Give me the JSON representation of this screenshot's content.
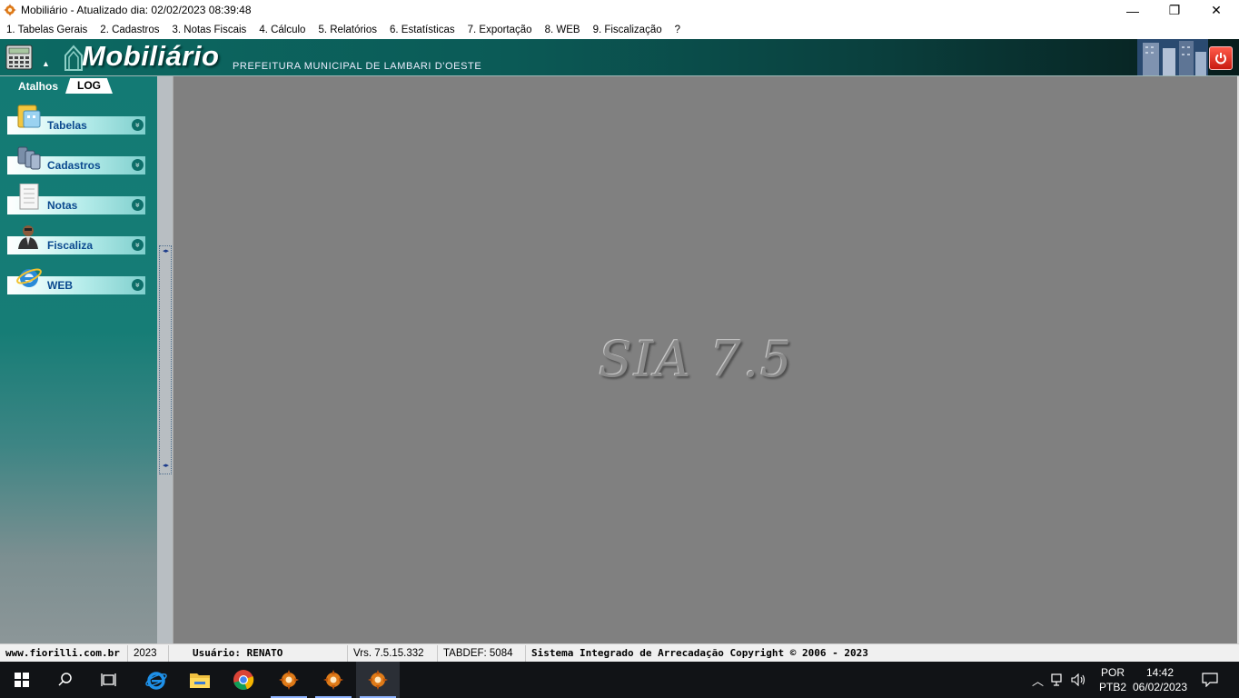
{
  "window": {
    "title": "Mobiliário - Atualizado dia: 02/02/2023 08:39:48",
    "controls": {
      "minimize": "—",
      "restore": "❐",
      "close": "✕"
    }
  },
  "menu": [
    {
      "label": "1. Tabelas Gerais"
    },
    {
      "label": "2. Cadastros"
    },
    {
      "label": "3. Notas Fiscais"
    },
    {
      "label": "4. Cálculo"
    },
    {
      "label": "5. Relatórios"
    },
    {
      "label": "6. Estatísticas"
    },
    {
      "label": "7. Exportação"
    },
    {
      "label": "8. WEB"
    },
    {
      "label": "9. Fiscalização"
    },
    {
      "label": "?"
    }
  ],
  "banner": {
    "app_name": "Mobiliário",
    "municipality": "PREFEITURA MUNICIPAL DE LAMBARI D'OESTE",
    "caret": "▲"
  },
  "sidebar": {
    "tab_shortcuts": "Atalhos",
    "tab_log": "LOG",
    "items": [
      {
        "label": "Tabelas",
        "icon": "tables-icon"
      },
      {
        "label": "Cadastros",
        "icon": "registers-icon"
      },
      {
        "label": "Notas",
        "icon": "notes-icon"
      },
      {
        "label": "Fiscaliza",
        "icon": "inspector-icon"
      },
      {
        "label": "WEB",
        "icon": "internet-explorer-icon"
      }
    ],
    "expand_glyph": "»"
  },
  "main": {
    "watermark": "SIA 7.5"
  },
  "status": {
    "site": "www.fiorilli.com.br",
    "year": "2023",
    "user": "Usuário: RENATO",
    "version": "Vrs. 7.5.15.332",
    "tabdef": "TABDEF: 5084",
    "copyright": "Sistema Integrado de Arrecadação Copyright © 2006 - 2023"
  },
  "taskbar": {
    "tray": {
      "language": "POR",
      "layout": "PTB2",
      "time": "14:42",
      "date": "06/02/2023"
    }
  },
  "colors": {
    "banner_teal": "#0c6a63",
    "sidebar_teal": "#137a74",
    "main_gray": "#808080",
    "label_blue": "#0b4a8f"
  }
}
